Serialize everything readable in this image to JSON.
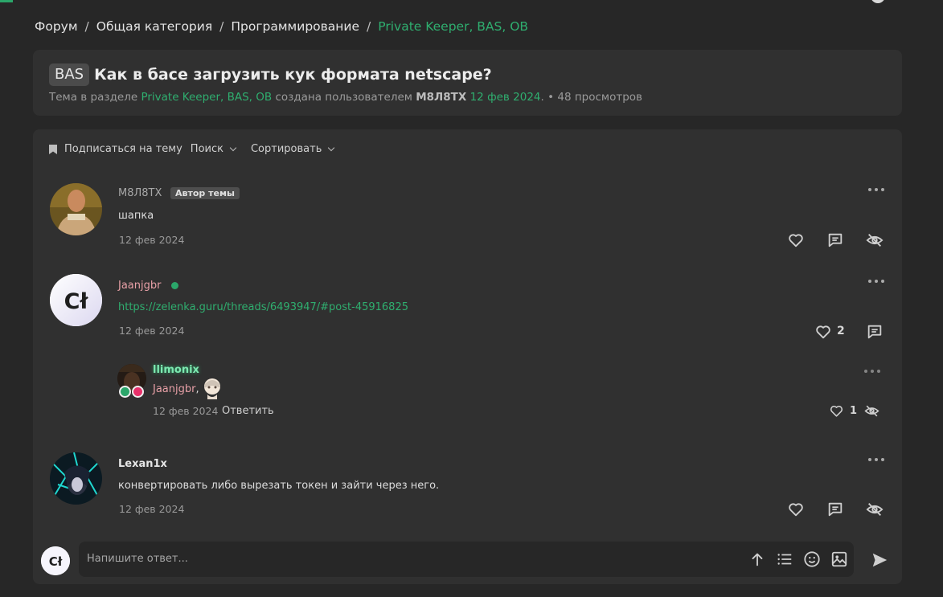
{
  "breadcrumb": {
    "items": [
      "Форум",
      "Общая категория",
      "Программирование",
      "Private Keeper, BAS, OB"
    ],
    "separator": "/"
  },
  "thread": {
    "prefix": "BAS",
    "title": "Как в басе загрузить кук формата netscape?",
    "meta_prefix": "Тема в разделе",
    "meta_section": "Private Keeper, BAS, OB",
    "meta_created_by": "создана пользователем",
    "meta_author": "M8Л8TX",
    "meta_date": "12 фев 2024",
    "meta_dot": ".",
    "meta_views": "• 48 просмотров"
  },
  "toolbar": {
    "subscribe": "Подписаться на тему",
    "search": "Поиск",
    "sort": "Сортировать"
  },
  "posts": [
    {
      "author": "M8Л8TX",
      "badge": "Автор темы",
      "text": "шапка",
      "date": "12 фев 2024"
    },
    {
      "author": "Jaanjgbr",
      "online": true,
      "link": "https://zelenka.guru/threads/6493947/#post-45916825",
      "date": "12 фев 2024",
      "likes": "2"
    },
    {
      "author": "Lexan1x",
      "text": "конвертировать либо вырезать токен и зайти через него.",
      "date": "12 фев 2024"
    }
  ],
  "comment": {
    "author": "llimonix",
    "mention": "Jaanjgbr",
    "mention_suffix": ",",
    "date": "12 фев 2024",
    "reply_label": "Ответить",
    "likes": "1"
  },
  "reply": {
    "placeholder": "Напишите ответ..."
  },
  "avatar_initials": "Cł",
  "colors": {
    "accent_green": "#2fae6f",
    "online_dot": "#2ba66a",
    "username_pink": "#e8a0a7",
    "llimonix_green": "#7de8b0",
    "bg": "#272727",
    "panel": "#303030"
  },
  "icons": [
    "bookmark-icon",
    "chevron-down-icon",
    "more-icon",
    "heart-icon",
    "comment-icon",
    "hide-icon",
    "arrow-up-icon",
    "list-icon",
    "smile-icon",
    "image-icon",
    "send-icon"
  ]
}
